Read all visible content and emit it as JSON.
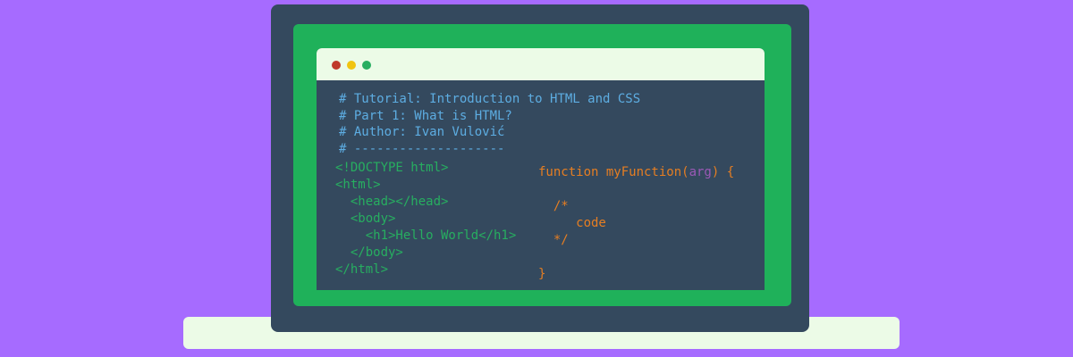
{
  "comments": [
    "# Tutorial: Introduction to HTML and CSS",
    "# Part 1: What is HTML?",
    "# Author: Ivan Vulović",
    "# --------------------"
  ],
  "html_code": [
    "<!DOCTYPE html>",
    "<html>",
    "  <head></head>",
    "  <body>",
    "    <h1>Hello World</h1>",
    "  </body>",
    "</html>"
  ],
  "js_code": {
    "line1_prefix": "function myFunction(",
    "line1_arg": "arg",
    "line1_suffix": ") {",
    "line2": "",
    "line3": "  /*",
    "line4": "     code",
    "line5": "  */",
    "line6": "",
    "line7": "}"
  },
  "colors": {
    "background": "#a66bff",
    "laptop_body": "#34495e",
    "screen_frame": "#1fb15a",
    "titlebar": "#ecfbe7",
    "comment_text": "#5dade2",
    "html_text": "#27ae60",
    "js_text": "#e67e22",
    "js_arg": "#9b59b6"
  },
  "icons": {
    "window_dots": [
      "close-dot-icon",
      "minimize-dot-icon",
      "maximize-dot-icon"
    ]
  }
}
